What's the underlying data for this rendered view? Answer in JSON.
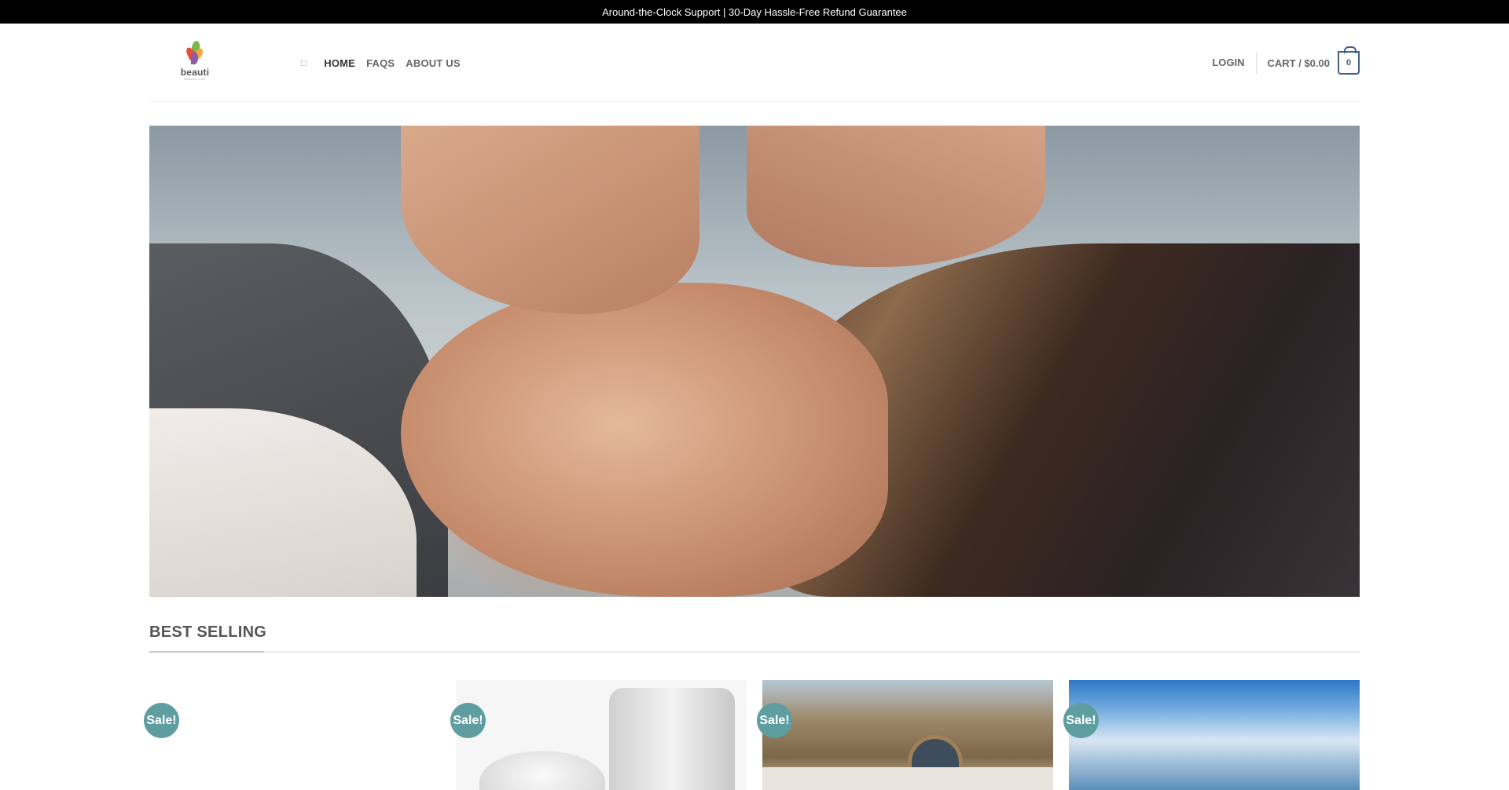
{
  "topbar": {
    "text": "Around-the-Clock Support | 30-Day Hassle-Free Refund Guarantee"
  },
  "logo": {
    "name": "beauti",
    "tagline": "beautilo.com"
  },
  "nav": {
    "items": [
      {
        "label": "HOME",
        "active": true
      },
      {
        "label": "FAQS",
        "active": false
      },
      {
        "label": "ABOUT US",
        "active": false
      }
    ]
  },
  "header": {
    "login_label": "LOGIN",
    "cart_label": "CART / $0.00",
    "cart_count": "0"
  },
  "hero": {
    "image": "woman-receiving-facial-treatment"
  },
  "section": {
    "title": "BEST SELLING"
  },
  "products": [
    {
      "badge": "Sale!"
    },
    {
      "badge": "Sale!"
    },
    {
      "badge": "Sale!"
    },
    {
      "badge": "Sale!"
    }
  ],
  "colors": {
    "accent": "#446084",
    "sale_badge": "#5f9ea0",
    "topbar": "#000000"
  }
}
